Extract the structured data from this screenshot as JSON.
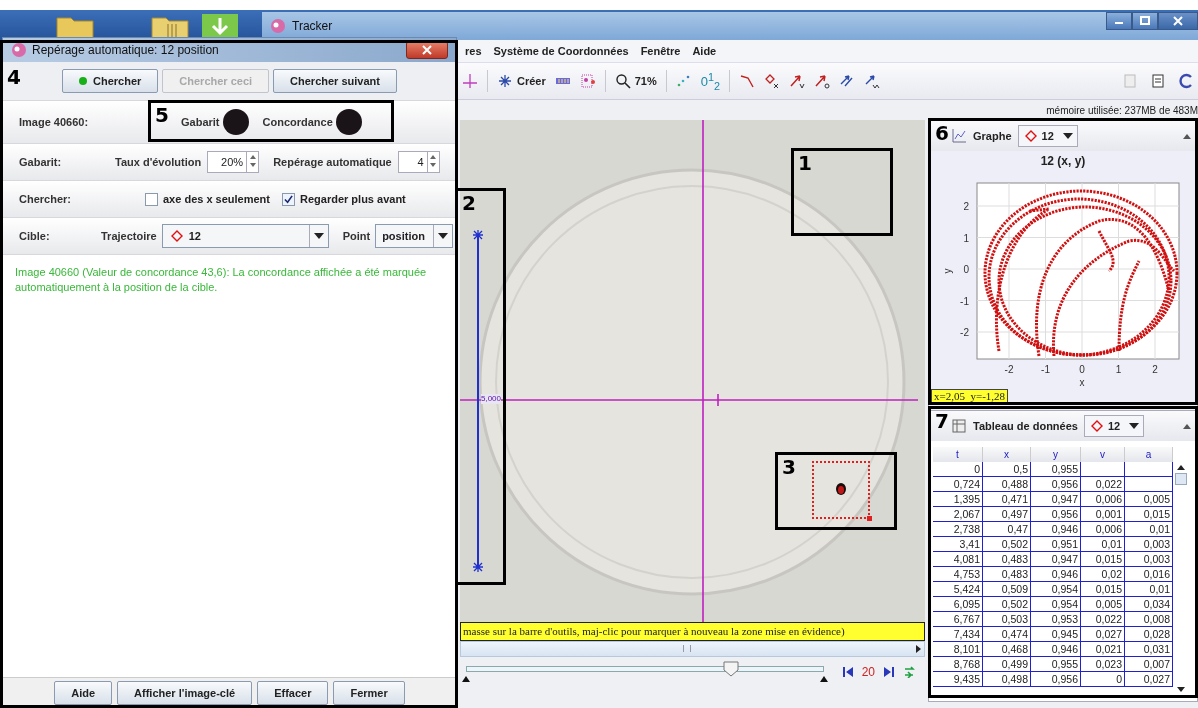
{
  "main_window": {
    "title": "Tracker",
    "menu": [
      "res",
      "Système de Coordonnées",
      "Fenêtre",
      "Aide"
    ],
    "toolbar": {
      "create": "Créer",
      "zoom": "71%",
      "numbering": "0$^{1}$$_{2}$"
    },
    "memory": "mémoire utilisée: 237MB de 483M",
    "video": {
      "scale_label": "5,000",
      "hint": "masse sur la barre d'outils, maj-clic pour marquer à nouveau la zone mise en évidence)",
      "player": {
        "level": 0.74,
        "frame": "20"
      }
    },
    "graph": {
      "title": "Graphe",
      "track": "12",
      "chart_title": "12 (x, y)",
      "xlabel": "x",
      "ylabel": "y",
      "xticks": [
        "-2",
        "-1",
        "0",
        "1",
        "2"
      ],
      "yticks": [
        "2",
        "1",
        "0",
        "-1",
        "-2"
      ],
      "readout": "x=2,05  y=-1,28"
    },
    "table": {
      "title": "Tableau de données",
      "track": "12",
      "columns": [
        "t",
        "x",
        "y",
        "v",
        "a"
      ],
      "rows": [
        [
          "0",
          "0,5",
          "0,955",
          null,
          null
        ],
        [
          "0,724",
          "0,488",
          "0,956",
          "0,022",
          null
        ],
        [
          "1,395",
          "0,471",
          "0,947",
          "0,006",
          "0,005"
        ],
        [
          "2,067",
          "0,497",
          "0,956",
          "0,001",
          "0,015"
        ],
        [
          "2,738",
          "0,47",
          "0,946",
          "0,006",
          "0,01"
        ],
        [
          "3,41",
          "0,502",
          "0,951",
          "0,01",
          "0,003"
        ],
        [
          "4,081",
          "0,483",
          "0,947",
          "0,015",
          "0,003"
        ],
        [
          "4,753",
          "0,483",
          "0,946",
          "0,02",
          "0,016"
        ],
        [
          "5,424",
          "0,509",
          "0,954",
          "0,015",
          "0,01"
        ],
        [
          "6,095",
          "0,502",
          "0,954",
          "0,005",
          "0,034"
        ],
        [
          "6,767",
          "0,503",
          "0,953",
          "0,022",
          "0,008"
        ],
        [
          "7,434",
          "0,474",
          "0,945",
          "0,027",
          "0,028"
        ],
        [
          "8,101",
          "0,468",
          "0,946",
          "0,021",
          "0,031"
        ],
        [
          "8,768",
          "0,499",
          "0,955",
          "0,023",
          "0,007"
        ],
        [
          "9,435",
          "0,498",
          "0,956",
          "0",
          "0,027"
        ]
      ]
    }
  },
  "dialog": {
    "title": "Repérage automatique: 12 position",
    "buttons": [
      {
        "label": "Chercher",
        "disabled": false,
        "indicator": true
      },
      {
        "label": "Chercher ceci",
        "disabled": true,
        "indicator": false
      },
      {
        "label": "Chercher suivant",
        "disabled": false,
        "indicator": false
      }
    ],
    "image_label": "Image 40660:",
    "template_label": "Gabarit",
    "match_label": "Concordance",
    "template": {
      "label": "Gabarit:",
      "rate_label": "Taux d'évolution",
      "rate": "20%",
      "auto_label": "Repérage automatique",
      "auto": "4"
    },
    "search": {
      "label": "Chercher:",
      "options": [
        {
          "label": "axe des x seulement",
          "checked": false
        },
        {
          "label": "Regarder plus avant",
          "checked": true
        }
      ]
    },
    "target": {
      "label": "Cible:",
      "track_label": "Trajectoire",
      "track": "12",
      "point_label": "Point",
      "point": "position"
    },
    "message": "Image 40660 (Valeur de concordance 43,6): La concordance affichée a été marquée automatiquement à la position de la cible.",
    "footer_buttons": [
      "Aide",
      "Afficher l'image-clé",
      "Effacer",
      "Fermer"
    ]
  },
  "annotations": [
    "1",
    "2",
    "3",
    "4",
    "5",
    "6",
    "7"
  ]
}
